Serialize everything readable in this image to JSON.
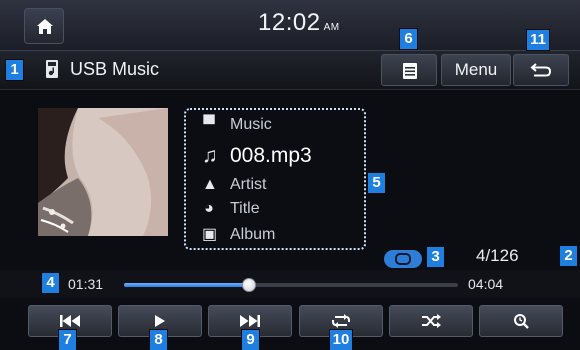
{
  "status_bar": {
    "time": "12:02",
    "ampm": "AM"
  },
  "header": {
    "source_title": "USB Music",
    "menu_label": "Menu"
  },
  "track_info": {
    "folder": "Music",
    "file": "008.mp3",
    "artist": "Artist",
    "title": "Title",
    "album": "Album"
  },
  "track_counter": "4/126",
  "playback": {
    "elapsed": "01:31",
    "total": "04:04",
    "progress_fraction": 0.373
  },
  "callouts": [
    "1",
    "2",
    "3",
    "4",
    "5",
    "6",
    "7",
    "8",
    "9",
    "10",
    "11"
  ],
  "controls": [
    "previous-icon",
    "play-icon",
    "next-icon",
    "repeat-icon",
    "shuffle-icon",
    "search-icon"
  ],
  "colors": {
    "accent": "#1f7fe0",
    "progress": "#2a7fe0",
    "background": "#0b0d12"
  }
}
